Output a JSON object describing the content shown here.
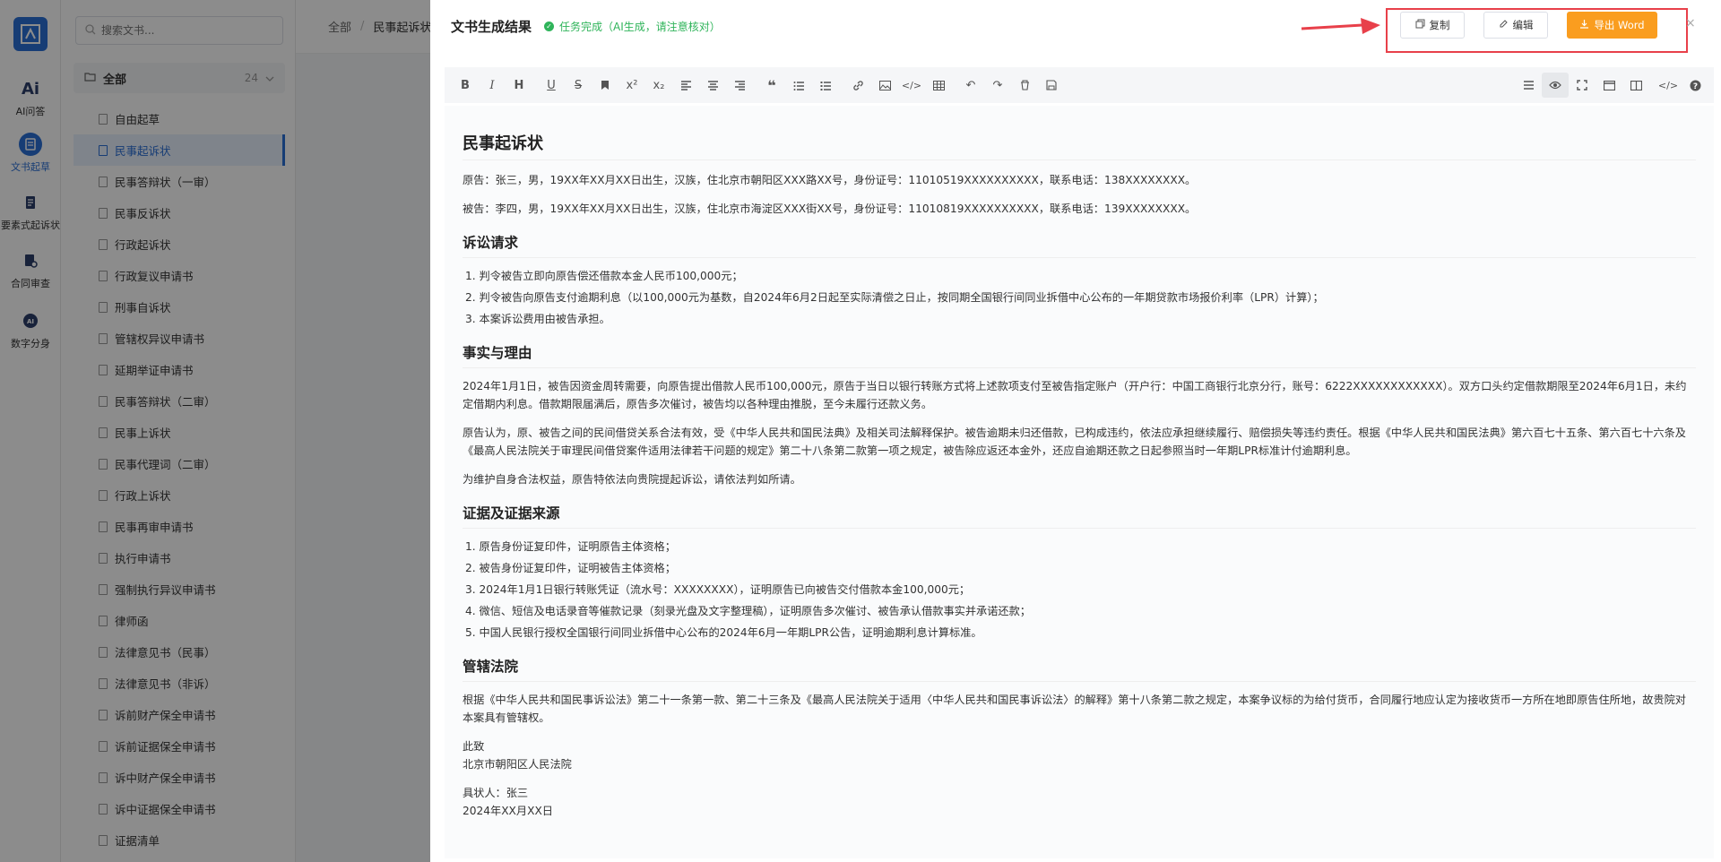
{
  "rail": {
    "items": [
      {
        "label": "AI问答"
      },
      {
        "label": "文书起草"
      },
      {
        "label": "要素式起诉状"
      },
      {
        "label": "合同审查"
      },
      {
        "label": "数字分身"
      }
    ]
  },
  "sidebar": {
    "search_placeholder": "搜索文书...",
    "group_label": "全部",
    "group_count": "24",
    "items": [
      "自由起草",
      "民事起诉状",
      "民事答辩状（一审）",
      "民事反诉状",
      "行政起诉状",
      "行政复议申请书",
      "刑事自诉状",
      "管辖权异议申请书",
      "延期举证申请书",
      "民事答辩状（二审）",
      "民事上诉状",
      "民事代理词（二审）",
      "行政上诉状",
      "民事再审申请书",
      "执行申请书",
      "强制执行异议申请书",
      "律师函",
      "法律意见书（民事）",
      "法律意见书（非诉）",
      "诉前财产保全申请书",
      "诉前证据保全申请书",
      "诉中财产保全申请书",
      "诉中证据保全申请书",
      "证据清单"
    ]
  },
  "breadcrumb": {
    "root": "全部",
    "current": "民事起诉状"
  },
  "drawer": {
    "title": "文书生成结果",
    "status": "任务完成（AI生成，请注意核对）",
    "copy_label": "复制",
    "edit_label": "编辑",
    "export_label": "导出 Word",
    "close": "×"
  },
  "doc": {
    "title": "民事起诉状",
    "plaintiff": "原告：张三，男，19XX年XX月XX日出生，汉族，住北京市朝阳区XXX路XX号，身份证号：11010519XXXXXXXXXX，联系电话：138XXXXXXXX。",
    "defendant": "被告：李四，男，19XX年XX月XX日出生，汉族，住北京市海淀区XXX街XX号，身份证号：11010819XXXXXXXXXX，联系电话：139XXXXXXXX。",
    "claims_title": "诉讼请求",
    "claims": [
      "1. 判令被告立即向原告偿还借款本金人民币100,000元；",
      "2. 判令被告向原告支付逾期利息（以100,000元为基数，自2024年6月2日起至实际清偿之日止，按同期全国银行间同业拆借中心公布的一年期贷款市场报价利率（LPR）计算）；",
      "3. 本案诉讼费用由被告承担。"
    ],
    "facts_title": "事实与理由",
    "facts_p1": "2024年1月1日，被告因资金周转需要，向原告提出借款人民币100,000元，原告于当日以银行转账方式将上述款项支付至被告指定账户（开户行：中国工商银行北京分行，账号：6222XXXXXXXXXXXX）。双方口头约定借款期限至2024年6月1日，未约定借期内利息。借款期限届满后，原告多次催讨，被告均以各种理由推脱，至今未履行还款义务。",
    "facts_p2": "原告认为，原、被告之间的民间借贷关系合法有效，受《中华人民共和国民法典》及相关司法解释保护。被告逾期未归还借款，已构成违约，依法应承担继续履行、赔偿损失等违约责任。根据《中华人民共和国民法典》第六百七十五条、第六百七十六条及《最高人民法院关于审理民间借贷案件适用法律若干问题的规定》第二十八条第二款第一项之规定，被告除应返还本金外，还应自逾期还款之日起参照当时一年期LPR标准计付逾期利息。",
    "facts_p3": "为维护自身合法权益，原告特依法向贵院提起诉讼，请依法判如所请。",
    "evidence_title": "证据及证据来源",
    "evidence": [
      "1. 原告身份证复印件，证明原告主体资格；",
      "2. 被告身份证复印件，证明被告主体资格；",
      "3. 2024年1月1日银行转账凭证（流水号：XXXXXXXX），证明原告已向被告交付借款本金100,000元；",
      "4. 微信、短信及电话录音等催款记录（刻录光盘及文字整理稿），证明原告多次催讨、被告承认借款事实并承诺还款；",
      "5. 中国人民银行授权全国银行间同业拆借中心公布的2024年6月一年期LPR公告，证明逾期利息计算标准。"
    ],
    "court_title": "管辖法院",
    "court_p": "根据《中华人民共和国民事诉讼法》第二十一条第一款、第二十三条及《最高人民法院关于适用〈中华人民共和国民事诉讼法〉的解释》第十八条第二款之规定，本案争议标的为给付货币，合同履行地应认定为接收货币一方所在地即原告住所地，故贵院对本案具有管辖权。",
    "closing_1": "此致",
    "closing_2": "北京市朝阳区人民法院",
    "signer": "具状人：张三",
    "date": "2024年XX月XX日"
  },
  "colors": {
    "accent": "#2b6fd6",
    "export": "#fa9d1f",
    "success": "#2fb45a",
    "annotation": "#e8404a"
  },
  "icons": [
    "bold-icon",
    "italic-icon",
    "heading-icon",
    "underline-icon",
    "strikethrough-icon",
    "bookmark-icon",
    "superscript-icon",
    "subscript-icon",
    "align-left-icon",
    "align-center-icon",
    "align-right-icon",
    "quote-icon",
    "ordered-list-icon",
    "unordered-list-icon",
    "link-icon",
    "image-icon",
    "code-icon",
    "table-icon",
    "undo-icon",
    "redo-icon",
    "clear-icon",
    "save-icon",
    "menu-icon",
    "preview-icon",
    "fullscreen-icon",
    "window-icon",
    "split-icon",
    "source-icon",
    "help-icon"
  ]
}
